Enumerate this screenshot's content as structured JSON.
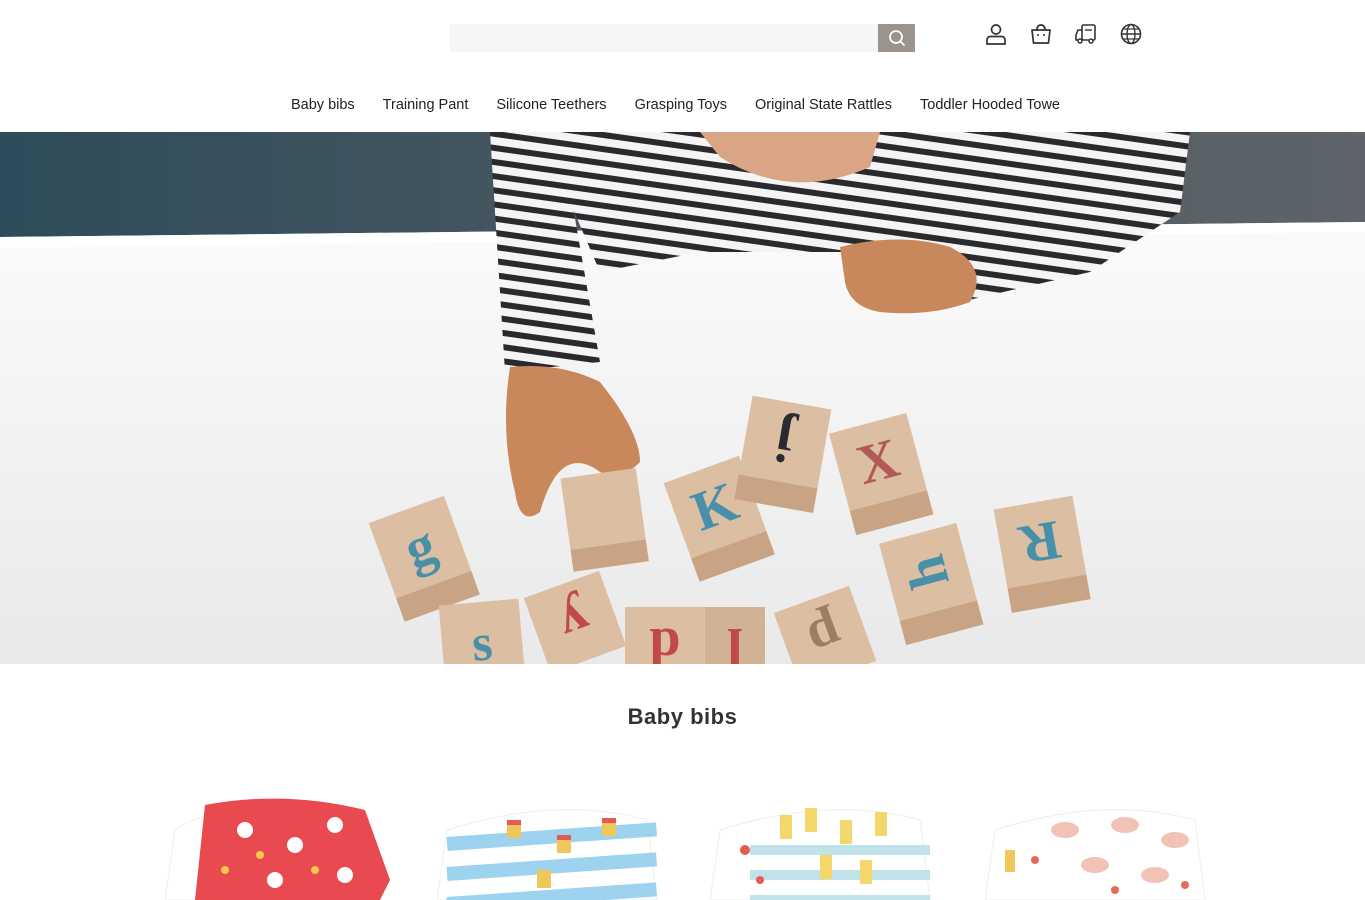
{
  "search": {
    "placeholder": "",
    "value": ""
  },
  "icons": [
    "account-icon",
    "cart-icon",
    "shipping-icon",
    "language-globe-icon"
  ],
  "nav": [
    "Baby bibs",
    "Training Pant",
    "Silicone Teethers",
    "Grasping Toys",
    "Original State Rattles",
    "Toddler Hooded Towe"
  ],
  "hero": {
    "block_letters": [
      "g",
      "K",
      "j",
      "X",
      "R",
      "h",
      "s",
      "y",
      "p",
      "d",
      "l"
    ]
  },
  "section": {
    "title": "Baby bibs"
  },
  "products": [
    {
      "name": "red-lucky-cat-bib-set",
      "accent": "#e84a4f"
    },
    {
      "name": "blue-noodle-bib-set",
      "accent": "#9dd3ef"
    },
    {
      "name": "yellow-fries-bib-set",
      "accent": "#f3d76a"
    },
    {
      "name": "pink-food-bib-set",
      "accent": "#f2c2b6"
    }
  ],
  "colors": {
    "search_button": "#9b938c",
    "search_field": "#f6f6f6"
  }
}
